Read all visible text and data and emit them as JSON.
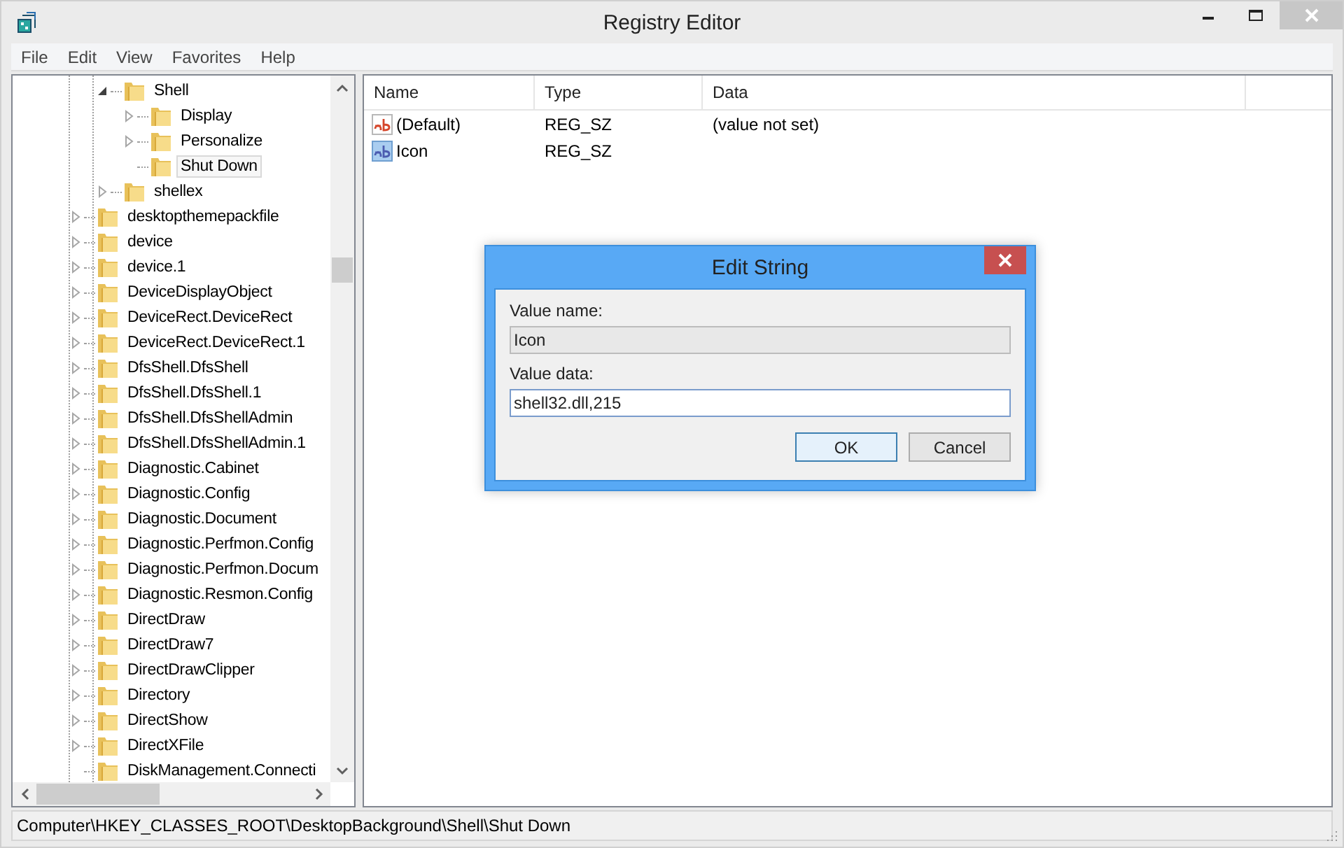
{
  "window": {
    "title": "Registry Editor"
  },
  "menu": [
    "File",
    "Edit",
    "View",
    "Favorites",
    "Help"
  ],
  "tree": {
    "continued_children": [
      {
        "label": "Shell",
        "expanded": true,
        "selected": false,
        "children": [
          {
            "label": "Display",
            "expanded": false,
            "selected": false
          },
          {
            "label": "Personalize",
            "expanded": false,
            "selected": false
          },
          {
            "label": "Shut Down",
            "selected": true
          }
        ]
      },
      {
        "label": "shellex",
        "expanded": false,
        "selected": false
      }
    ],
    "items": [
      {
        "label": "desktopthemepackfile",
        "expanded": false,
        "selected": false
      },
      {
        "label": "device",
        "expanded": false,
        "selected": false
      },
      {
        "label": "device.1",
        "expanded": false,
        "selected": false
      },
      {
        "label": "DeviceDisplayObject",
        "expanded": false,
        "selected": false
      },
      {
        "label": "DeviceRect.DeviceRect",
        "expanded": false,
        "selected": false
      },
      {
        "label": "DeviceRect.DeviceRect.1",
        "expanded": false,
        "selected": false
      },
      {
        "label": "DfsShell.DfsShell",
        "expanded": false,
        "selected": false
      },
      {
        "label": "DfsShell.DfsShell.1",
        "expanded": false,
        "selected": false
      },
      {
        "label": "DfsShell.DfsShellAdmin",
        "expanded": false,
        "selected": false
      },
      {
        "label": "DfsShell.DfsShellAdmin.1",
        "expanded": false,
        "selected": false
      },
      {
        "label": "Diagnostic.Cabinet",
        "expanded": false,
        "selected": false
      },
      {
        "label": "Diagnostic.Config",
        "expanded": false,
        "selected": false
      },
      {
        "label": "Diagnostic.Document",
        "expanded": false,
        "selected": false
      },
      {
        "label": "Diagnostic.Perfmon.Config",
        "expanded": false,
        "selected": false
      },
      {
        "label": "Diagnostic.Perfmon.Docum",
        "expanded": false,
        "selected": false
      },
      {
        "label": "Diagnostic.Resmon.Config",
        "expanded": false,
        "selected": false
      },
      {
        "label": "DirectDraw",
        "expanded": false,
        "selected": false
      },
      {
        "label": "DirectDraw7",
        "expanded": false,
        "selected": false
      },
      {
        "label": "DirectDrawClipper",
        "expanded": false,
        "selected": false
      },
      {
        "label": "Directory",
        "expanded": false,
        "selected": false
      },
      {
        "label": "DirectShow",
        "expanded": false,
        "selected": false
      },
      {
        "label": "DirectXFile",
        "expanded": false,
        "selected": false
      },
      {
        "label": "DiskManagement.Connecti",
        "selected": false
      }
    ]
  },
  "values": {
    "columns": [
      "Name",
      "Type",
      "Data"
    ],
    "rows": [
      {
        "name": "(Default)",
        "type": "REG_SZ",
        "data": "(value not set)",
        "selected": false
      },
      {
        "name": "Icon",
        "type": "REG_SZ",
        "selected": true
      }
    ]
  },
  "dialog": {
    "title": "Edit String",
    "name_label": "Value name:",
    "name_value": "Icon",
    "data_label": "Value data:",
    "data_value": "shell32.dll,215",
    "buttons": [
      {
        "label": "OK",
        "kind": "default"
      },
      {
        "label": "Cancel",
        "kind": "normal"
      }
    ]
  },
  "status_bar": "Computer\\HKEY_CLASSES_ROOT\\DesktopBackground\\Shell\\Shut Down"
}
